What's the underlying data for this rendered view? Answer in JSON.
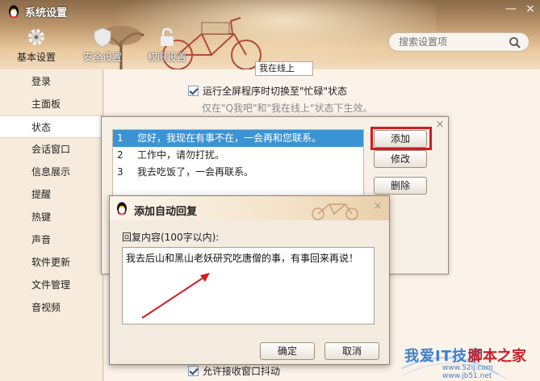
{
  "window": {
    "title": "系统设置",
    "minimize_glyph": "—",
    "close_glyph": "×"
  },
  "nav_tabs": [
    {
      "label": "基本设置",
      "icon": "gear-icon",
      "active": true
    },
    {
      "label": "安全设置",
      "icon": "shield-icon",
      "active": false
    },
    {
      "label": "权限设置",
      "icon": "lock-icon",
      "active": false
    }
  ],
  "search": {
    "placeholder": "搜索设置项",
    "icon": "search-icon"
  },
  "sidebar": {
    "items": [
      {
        "label": "登录"
      },
      {
        "label": "主面板"
      },
      {
        "label": "状态",
        "active": true
      },
      {
        "label": "会话窗口"
      },
      {
        "label": "信息展示"
      },
      {
        "label": "提醒"
      },
      {
        "label": "热键"
      },
      {
        "label": "声音"
      },
      {
        "label": "软件更新"
      },
      {
        "label": "文件管理"
      },
      {
        "label": "音视频"
      }
    ]
  },
  "status_settings": {
    "status_value": "我在线上",
    "fullscreen_busy_label": "运行全屏程序时切换至\"忙碌\"状态",
    "fullscreen_busy_checked": true,
    "fullscreen_busy_hint": "仅在\"Q我吧\"和\"我在线上\"状态下生效。",
    "allow_shake_label": "允许接收窗口抖动",
    "allow_shake_checked": true
  },
  "auto_reply_dialog": {
    "close_glyph": "×",
    "replies": [
      {
        "num": "1",
        "text": "您好，我现在有事不在，一会再和您联系。",
        "selected": true
      },
      {
        "num": "2",
        "text": "工作中，请勿打扰。",
        "selected": false
      },
      {
        "num": "3",
        "text": "我去吃饭了，一会再联系。",
        "selected": false
      }
    ],
    "add_label": "添加",
    "edit_label": "修改",
    "delete_label": "删除"
  },
  "add_reply_dialog": {
    "title": "添加自动回复",
    "close_glyph": "×",
    "content_label": "回复内容(100字以内):",
    "content_value": "我去后山和黑山老妖研究吃唐僧的事，有事回来再说！",
    "ok_label": "确定",
    "cancel_label": "取消"
  },
  "watermark": {
    "text_blue": "我爱IT技术",
    "text_red": "脚本之家",
    "url": "www.52ij.com  www.jb51.net"
  },
  "colors": {
    "selection": "#3b93d4",
    "highlight_box": "#d21a22",
    "arrow": "#d21a22"
  }
}
